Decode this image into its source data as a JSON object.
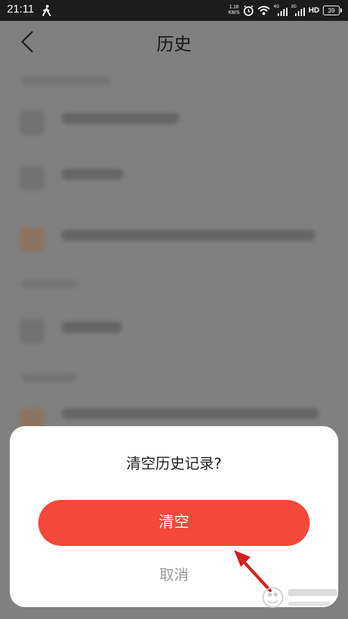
{
  "status_bar": {
    "time": "21:11",
    "net_speed_value": "1.18",
    "net_speed_unit": "KB/S",
    "sim1_label": "4G",
    "sim2_label": "3G",
    "hd_label": "HD",
    "battery": "39"
  },
  "header": {
    "title": "历史"
  },
  "dialog": {
    "title": "清空历史记录?",
    "confirm_label": "清空",
    "cancel_label": "取消"
  },
  "colors": {
    "accent": "#f5473a",
    "overlay": "#808080"
  }
}
